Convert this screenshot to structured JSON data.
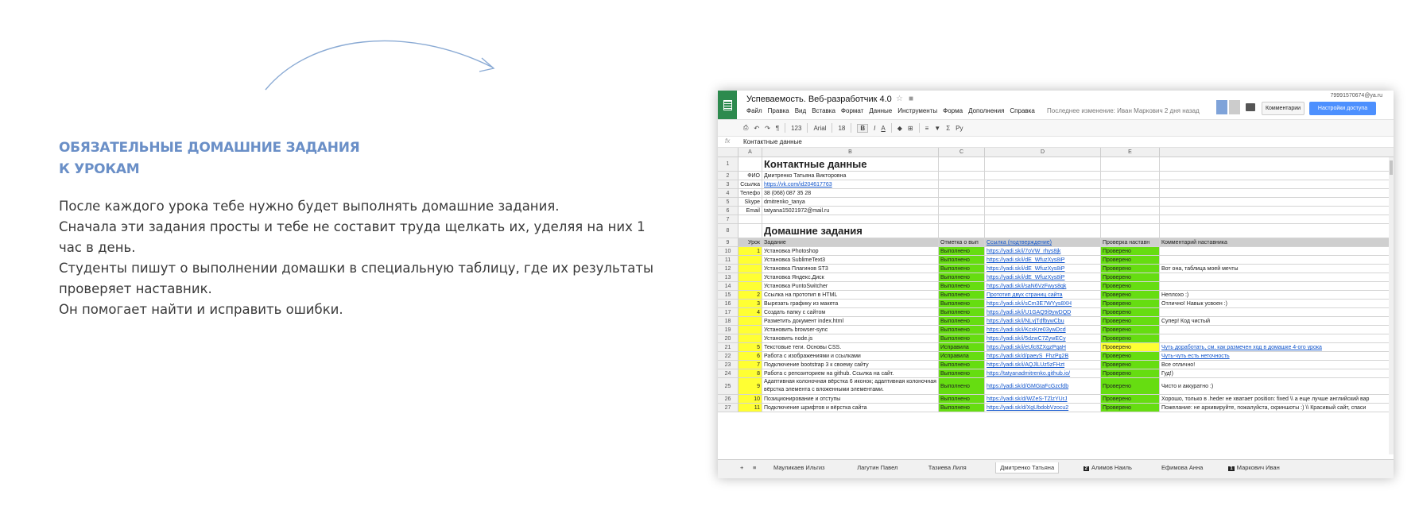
{
  "left": {
    "heading_line1": "ОБЯЗАТЕЛЬНЫЕ ДОМАШНИЕ ЗАДАНИЯ",
    "heading_line2": "К УРОКАМ",
    "paragraphs": [
      "После каждого урока тебе нужно будет выполнять домашние задания.",
      "Сначала эти задания просты и тебе не составит труда щелкать их, уделяя на них 1 час в день.",
      "Студенты пишут о выполнении домашки в специальную таблицу, где их результаты проверяет наставник.",
      "Он помогает найти и исправить ошибки."
    ]
  },
  "sheet": {
    "title": "Успеваемость. Веб-разработчик 4.0",
    "email": "79991570674@ya.ru",
    "menu": [
      "Файл",
      "Правка",
      "Вид",
      "Вставка",
      "Формат",
      "Данные",
      "Инструменты",
      "Форма",
      "Дополнения",
      "Справка"
    ],
    "last_edit": "Последнее изменение: Иван Маркович 2 дня назад",
    "comments_btn": "Комментарии",
    "share_btn": "Настройки доступа",
    "toolbar": {
      "font": "Arial",
      "size": "18",
      "zoom": "123",
      "bold": "B",
      "italic": "I",
      "lang": "Ру"
    },
    "formula_label": "fx",
    "formula_value": "Контактные данные",
    "columns": [
      "A",
      "B",
      "C",
      "D",
      "E"
    ],
    "rows": [
      {
        "n": "1",
        "b": "Контактные данные",
        "type": "big"
      },
      {
        "n": "2",
        "a": "ФИО",
        "b": "Дмитренко Татьяна Викторовна"
      },
      {
        "n": "3",
        "a": "Ссылка",
        "b": "https://vk.com/id204617763",
        "link": true
      },
      {
        "n": "4",
        "a": "Телефо",
        "b": "38 (068) 087 35 28"
      },
      {
        "n": "5",
        "a": "Skype",
        "b": "dmitrenko_tanya"
      },
      {
        "n": "6",
        "a": "Email",
        "b": "tatyana15021972@mail.ru"
      },
      {
        "n": "7"
      },
      {
        "n": "8",
        "b": "Домашние задания",
        "type": "big"
      },
      {
        "n": "9",
        "a": "Урок",
        "b": "Задание",
        "c": "Отметка о вып",
        "d": "Ссылка (подтверждение)",
        "e": "Проверка наставн",
        "f": "Комментарий наставника",
        "type": "hdr"
      },
      {
        "n": "10",
        "a": "1",
        "b": "Установка Photoshop",
        "c": "Выполнено",
        "d": "https://yadi.sk/i/7oVW_rhys8jk",
        "e": "Проверено"
      },
      {
        "n": "11",
        "b": "Установка SublimeText3",
        "c": "Выполнено",
        "d": "https://yadi.sk/i/dE_WfuzXys8iP",
        "e": "Проверено"
      },
      {
        "n": "12",
        "b": "Установка Плагинов ST3",
        "c": "Выполнено",
        "d": "https://yadi.sk/i/dE_WfuzXys8iP",
        "e": "Проверено",
        "f": "Вот она, таблица моей мечты"
      },
      {
        "n": "13",
        "b": "Установка Яндекс.Диск",
        "c": "Выполнено",
        "d": "https://yadi.sk/i/dE_WfuzXys8iP",
        "e": "Проверено"
      },
      {
        "n": "14",
        "b": "Установка PuntoSwitcher",
        "c": "Выполнено",
        "d": "https://yadi.sk/i/saN6VzFwys8qk",
        "e": "Проверено"
      },
      {
        "n": "15",
        "a": "2",
        "b": "Ссылка на прототип в HTML",
        "c": "Выполнено",
        "d": "Прототип двух страниц сайта",
        "e": "Проверено",
        "f": "Неплохо :)"
      },
      {
        "n": "16",
        "a": "3",
        "b": "Вырезать графику из макета",
        "c": "Выполнено",
        "d": "https://yadi.sk/i/sCm3E7WYys8XH",
        "e": "Проверено",
        "f": "Отлично! Навык усвоен :)"
      },
      {
        "n": "17",
        "a": "4",
        "b": "Создать папку с сайтом",
        "c": "Выполнено",
        "d": "https://yadi.sk/i/U1GAQ9i9ywDQD",
        "e": "Проверено"
      },
      {
        "n": "18",
        "b": "Разметить документ index.html",
        "c": "Выполнено",
        "d": "https://yadi.sk/i/NLvjTdfbywCbu",
        "e": "Проверено",
        "f": "Супер! Код чистый"
      },
      {
        "n": "19",
        "b": "Установить browser-sync",
        "c": "Выполнено",
        "d": "https://yadi.sk/i/KcxKre03ywDcd",
        "e": "Проверено"
      },
      {
        "n": "20",
        "b": "Установить node.js",
        "c": "Выполнено",
        "d": "https://yadi.sk/i/5dzwC7ZywECy",
        "e": "Проверено"
      },
      {
        "n": "21",
        "a": "5",
        "b": "Текстовые теги. Основы CSS.",
        "c": "Исправила",
        "d": "https://yadi.sk/i/eUlc8ZXgzPqaH",
        "e": "Проверено",
        "f": "Чуть доработать, см. как размечен ход в домашке 4-ого урока",
        "flink": true,
        "eyel": true
      },
      {
        "n": "22",
        "a": "6",
        "b": "Работа с изображениями и ссылками",
        "c": "Исправила",
        "d": "https://yadi.sk/d/paeyS_FhzPg2B",
        "e": "Проверено",
        "f": "Чуть-чуть есть неточность",
        "flink": true
      },
      {
        "n": "23",
        "a": "7",
        "b": "Подключение bootstrap 3 к своему сайту",
        "c": "Выполнено",
        "d": "https://yadi.sk/i/AQJlLUz5zFHzt",
        "e": "Проверено",
        "f": "Все отлично!"
      },
      {
        "n": "24",
        "a": "8",
        "b": "Работа с репозиторием на github. Ссылка на сайт.",
        "c": "Выполнено",
        "d": "https://tatyanadmitrenko.github.io/",
        "e": "Проверено",
        "f": "Гуд!)"
      },
      {
        "n": "25",
        "a": "9",
        "b": "Адаптивная колоночная вёрстка 6 иконок; адаптивная колоночная вёрстка элемента с вложенными элементами.",
        "c": "Выполнено",
        "d": "https://yadi.sk/d/GMGtaFcGzcfdb",
        "e": "Проверено",
        "f": "Чисто и аккуратно :)",
        "type": "tall"
      },
      {
        "n": "26",
        "a": "10",
        "b": "Позиционирование и отступы",
        "c": "Выполнено",
        "d": "https://yadi.sk/d/WZeS-TZlzYUrJ",
        "e": "Проверено",
        "f": "Хорошо, только в .heder не хватает position: fixed \\\\ а еще лучше английский вар"
      },
      {
        "n": "27",
        "a": "11",
        "b": "Подключение шрифтов и вёрстка сайта",
        "c": "Выполнено",
        "d": "https://yadi.sk/d/XgUbdobVzocu2",
        "e": "Проверено",
        "f": "Пожелание: не архивируйте, пожалуйста, скриншоты :) \\\\ Красивый сайт, спаси"
      }
    ],
    "tabs": [
      "Мауликаев Ильгиз",
      "Лагутин Павел",
      "Тазиева Лиля",
      "Дмитренко Татьяна",
      "Алимов Наиль",
      "Ефимова Анна",
      "Маркович Иван"
    ],
    "tab_badges": [
      "",
      "",
      "",
      "",
      "2",
      "",
      "1"
    ]
  },
  "colors": {
    "heading": "#6a8fc7",
    "green": "#66dd11",
    "yellow": "#ffff33",
    "share": "#4d90fe",
    "logo": "#2d8a4e"
  }
}
